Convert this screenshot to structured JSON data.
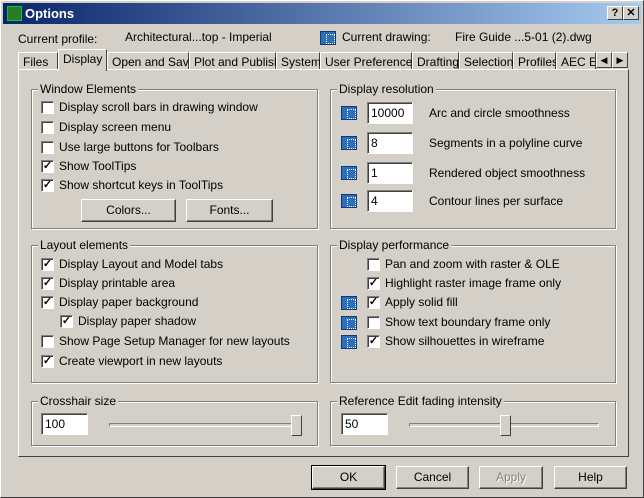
{
  "window": {
    "title": "Options",
    "help_label": "?",
    "close_label": "✕"
  },
  "profile": {
    "label": "Current profile:",
    "value": "Architectural...top - Imperial",
    "drawing_label": "Current drawing:",
    "drawing_value": "Fire Guide ...5-01 (2).dwg"
  },
  "tabs": [
    "Files",
    "Display",
    "Open and Save",
    "Plot and Publish",
    "System",
    "User Preferences",
    "Drafting",
    "Selection",
    "Profiles",
    "AEC Ed"
  ],
  "active_tab": "Display",
  "window_elements": {
    "title": "Window Elements",
    "items": [
      {
        "label": "Display scroll bars in drawing window",
        "checked": false
      },
      {
        "label": "Display screen menu",
        "checked": false
      },
      {
        "label": "Use large buttons for Toolbars",
        "checked": false
      },
      {
        "label": "Show ToolTips",
        "checked": true
      },
      {
        "label": "Show shortcut keys in ToolTips",
        "checked": true
      }
    ],
    "colors_button": "Colors...",
    "fonts_button": "Fonts..."
  },
  "display_resolution": {
    "title": "Display resolution",
    "items": [
      {
        "value": "10000",
        "label": "Arc and circle smoothness"
      },
      {
        "value": "8",
        "label": "Segments in a polyline curve"
      },
      {
        "value": "1",
        "label": "Rendered object smoothness"
      },
      {
        "value": "4",
        "label": "Contour lines per surface"
      }
    ]
  },
  "layout_elements": {
    "title": "Layout elements",
    "items": [
      {
        "label": "Display Layout and Model tabs",
        "checked": true
      },
      {
        "label": "Display printable area",
        "checked": true
      },
      {
        "label": "Display paper background",
        "checked": true
      },
      {
        "label": "Display paper shadow",
        "checked": true
      },
      {
        "label": "Show Page Setup Manager for new layouts",
        "checked": false
      },
      {
        "label": "Create viewport in new layouts",
        "checked": true
      }
    ]
  },
  "display_performance": {
    "title": "Display performance",
    "items": [
      {
        "label": "Pan and zoom with raster & OLE",
        "checked": false
      },
      {
        "label": "Highlight raster image frame only",
        "checked": true
      },
      {
        "label": "Apply solid fill",
        "checked": true
      },
      {
        "label": "Show text boundary frame only",
        "checked": false
      },
      {
        "label": "Show silhouettes in wireframe",
        "checked": true
      }
    ]
  },
  "crosshair": {
    "title": "Crosshair size",
    "value": "100",
    "slider_percent": 100
  },
  "ref_edit": {
    "title": "Reference Edit fading intensity",
    "value": "50",
    "slider_percent": 50
  },
  "buttons": {
    "ok": "OK",
    "cancel": "Cancel",
    "apply": "Apply",
    "help": "Help"
  }
}
